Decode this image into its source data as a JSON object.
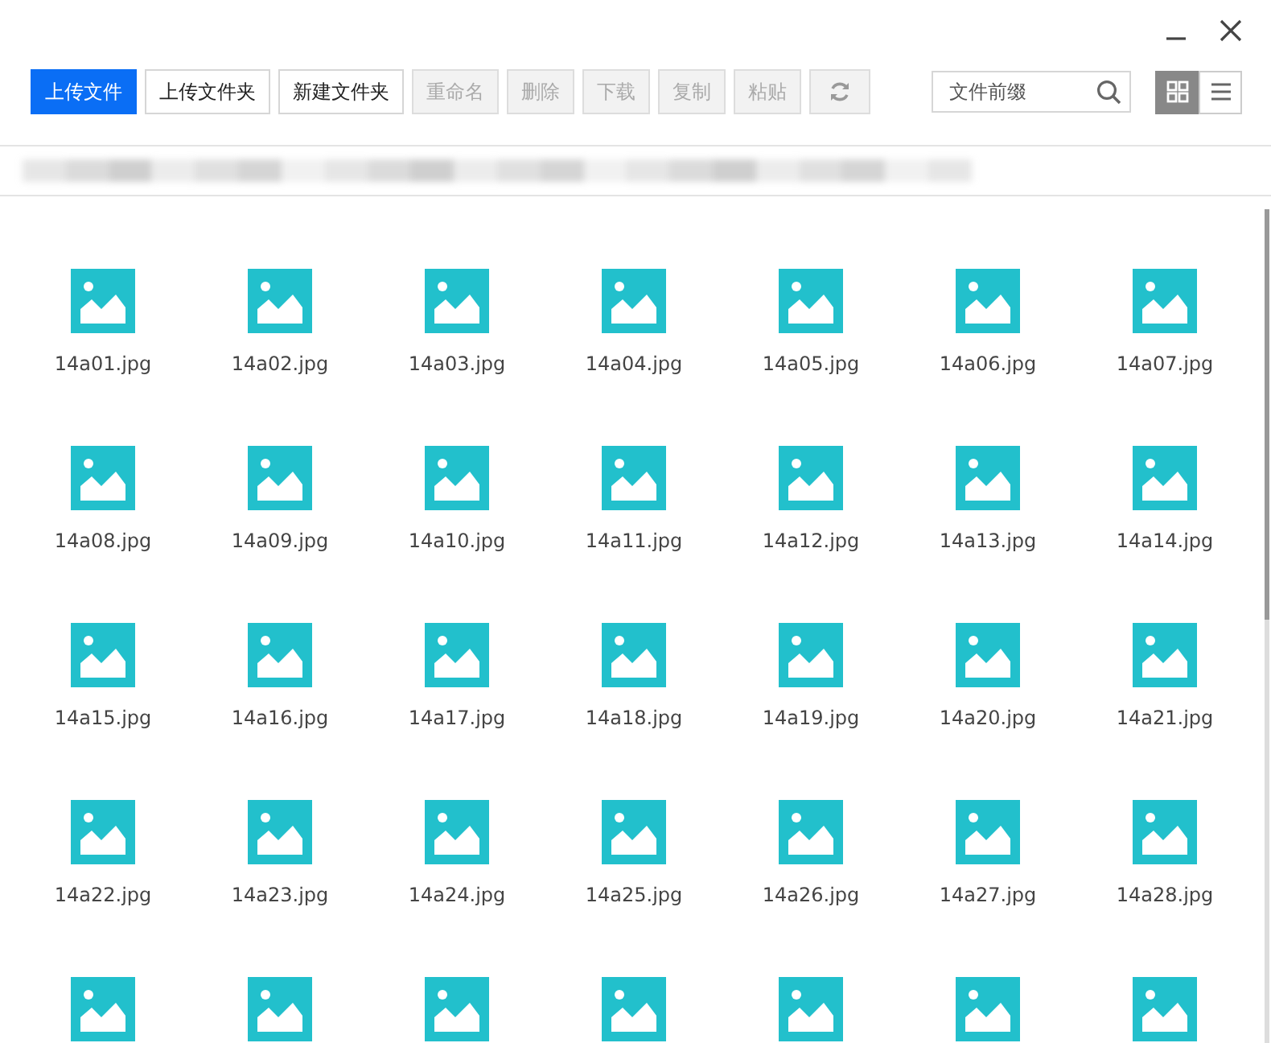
{
  "toolbar": {
    "buttons": [
      {
        "label": "上传文件",
        "kind": "primary",
        "disabled": false
      },
      {
        "label": "上传文件夹",
        "kind": "normal",
        "disabled": false
      },
      {
        "label": "新建文件夹",
        "kind": "normal",
        "disabled": false
      },
      {
        "label": "重命名",
        "kind": "normal",
        "disabled": true
      },
      {
        "label": "删除",
        "kind": "normal",
        "disabled": true
      },
      {
        "label": "下载",
        "kind": "normal",
        "disabled": true
      },
      {
        "label": "复制",
        "kind": "normal",
        "disabled": true
      },
      {
        "label": "粘贴",
        "kind": "normal",
        "disabled": true
      },
      {
        "kind": "refresh",
        "disabled": true
      }
    ],
    "search": {
      "placeholder": "文件前缀"
    },
    "views": [
      {
        "kind": "grid",
        "selected": true
      },
      {
        "kind": "list",
        "selected": false
      }
    ]
  },
  "files": [
    {
      "kind": "image",
      "name": "14a01.jpg"
    },
    {
      "kind": "image",
      "name": "14a02.jpg"
    },
    {
      "kind": "image",
      "name": "14a03.jpg"
    },
    {
      "kind": "image",
      "name": "14a04.jpg"
    },
    {
      "kind": "image",
      "name": "14a05.jpg"
    },
    {
      "kind": "image",
      "name": "14a06.jpg"
    },
    {
      "kind": "image",
      "name": "14a07.jpg"
    },
    {
      "kind": "image",
      "name": "14a08.jpg"
    },
    {
      "kind": "image",
      "name": "14a09.jpg"
    },
    {
      "kind": "image",
      "name": "14a10.jpg"
    },
    {
      "kind": "image",
      "name": "14a11.jpg"
    },
    {
      "kind": "image",
      "name": "14a12.jpg"
    },
    {
      "kind": "image",
      "name": "14a13.jpg"
    },
    {
      "kind": "image",
      "name": "14a14.jpg"
    },
    {
      "kind": "image",
      "name": "14a15.jpg"
    },
    {
      "kind": "image",
      "name": "14a16.jpg"
    },
    {
      "kind": "image",
      "name": "14a17.jpg"
    },
    {
      "kind": "image",
      "name": "14a18.jpg"
    },
    {
      "kind": "image",
      "name": "14a19.jpg"
    },
    {
      "kind": "image",
      "name": "14a20.jpg"
    },
    {
      "kind": "image",
      "name": "14a21.jpg"
    },
    {
      "kind": "image",
      "name": "14a22.jpg"
    },
    {
      "kind": "image",
      "name": "14a23.jpg"
    },
    {
      "kind": "image",
      "name": "14a24.jpg"
    },
    {
      "kind": "image",
      "name": "14a25.jpg"
    },
    {
      "kind": "image",
      "name": "14a26.jpg"
    },
    {
      "kind": "image",
      "name": "14a27.jpg"
    },
    {
      "kind": "image",
      "name": "14a28.jpg"
    },
    {
      "kind": "image"
    },
    {
      "kind": "image"
    },
    {
      "kind": "image"
    },
    {
      "kind": "image"
    },
    {
      "kind": "image"
    },
    {
      "kind": "image"
    },
    {
      "kind": "image"
    }
  ]
}
